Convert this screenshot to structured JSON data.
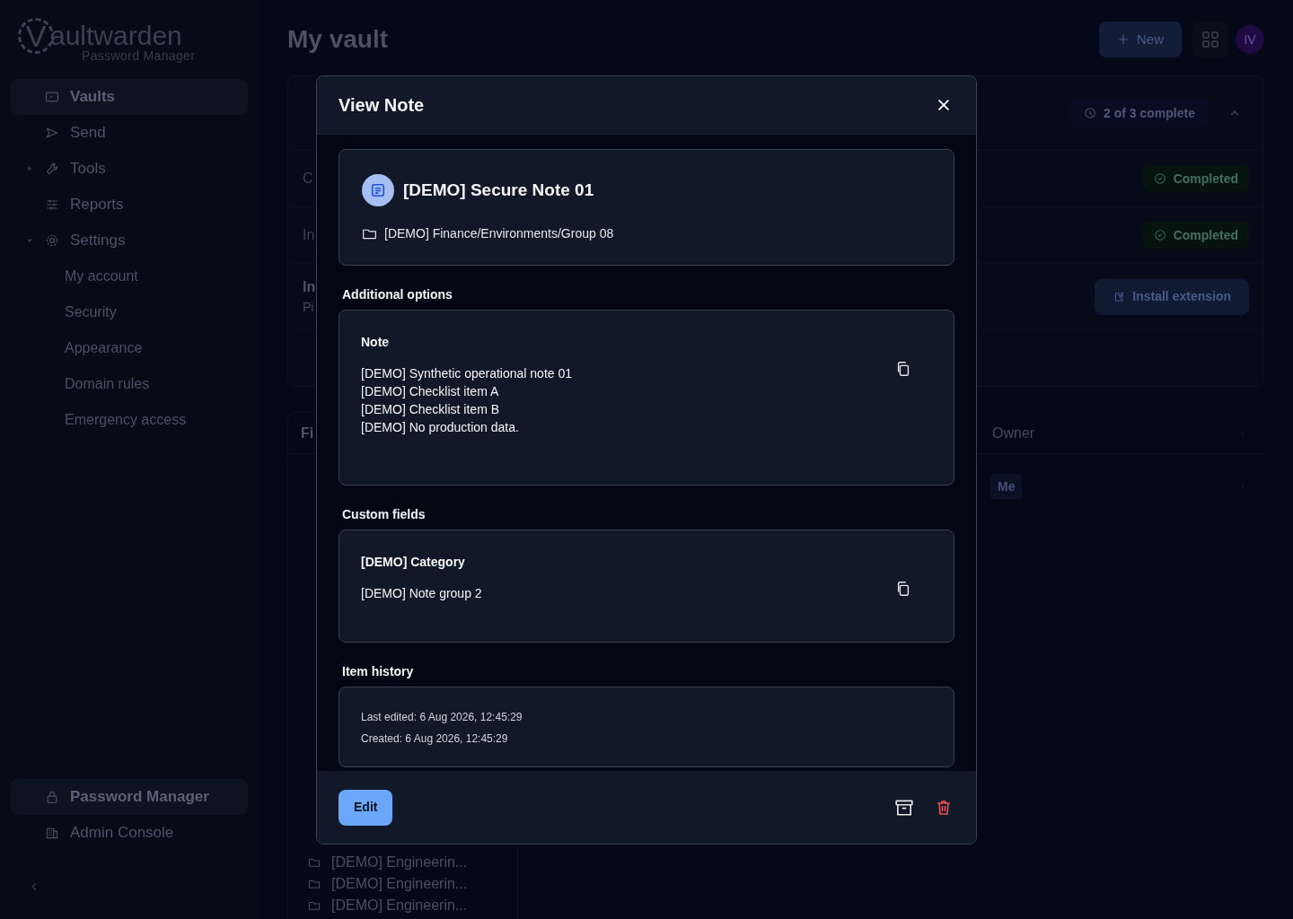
{
  "sidebar": {
    "logo": {
      "initial": "V",
      "rest": "aultwarden",
      "subtitle": "Password Manager"
    },
    "items": [
      {
        "label": "Vaults",
        "selected": true
      },
      {
        "label": "Send",
        "selected": false
      },
      {
        "label": "Tools",
        "selected": false,
        "expanded": false
      },
      {
        "label": "Reports",
        "selected": false
      },
      {
        "label": "Settings",
        "selected": false,
        "expanded": true,
        "children": [
          {
            "label": "My account"
          },
          {
            "label": "Security"
          },
          {
            "label": "Appearance"
          },
          {
            "label": "Domain rules"
          },
          {
            "label": "Emergency access"
          }
        ]
      }
    ],
    "products": [
      {
        "label": "Password Manager",
        "selected": true
      },
      {
        "label": "Admin Console",
        "selected": false
      }
    ]
  },
  "header": {
    "title": "My vault",
    "new_button": "New",
    "avatar": "IV"
  },
  "onboarding": {
    "progress": "2 of 3 complete",
    "rows": [
      {
        "fragment": "C",
        "status": "Completed",
        "kind": "badge"
      },
      {
        "fragment": "In",
        "status": "Completed",
        "kind": "badge"
      },
      {
        "fragment": "In",
        "subtitle": "Pi",
        "status": "Install extension",
        "kind": "button"
      }
    ]
  },
  "filters": {
    "heading": "Fi",
    "folders": [
      "[DEMO] Engineerin...",
      "[DEMO] Engineerin...",
      "[DEMO] Engineerin..."
    ]
  },
  "table": {
    "owner_column": "Owner",
    "rows": [
      {
        "owner": "Me"
      }
    ]
  },
  "modal": {
    "title": "View Note",
    "item": {
      "name": "[DEMO] Secure Note 01",
      "folder": "[DEMO] Finance/Environments/Group 08"
    },
    "additional_options": {
      "heading": "Additional options",
      "label": "Note",
      "text": "[DEMO] Synthetic operational note 01\n[DEMO] Checklist item A\n[DEMO] Checklist item B\n[DEMO] No production data."
    },
    "custom_fields": {
      "heading": "Custom fields",
      "fields": [
        {
          "name": "[DEMO] Category",
          "value": "[DEMO] Note group 2"
        }
      ]
    },
    "history": {
      "heading": "Item history",
      "lines": [
        "Last edited: 6 Aug 2026, 12:45:29",
        "Created: 6 Aug 2026, 12:45:29"
      ]
    },
    "edit_button": "Edit"
  }
}
